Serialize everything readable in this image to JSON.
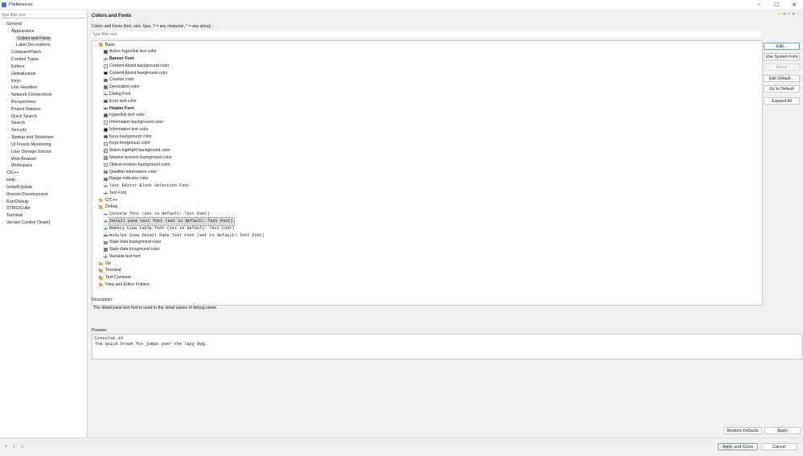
{
  "window": {
    "title": "Preferences",
    "controls": [
      "–",
      "☐",
      "✕"
    ]
  },
  "nav": {
    "filter_placeholder": "type filter text",
    "items": [
      {
        "label": "General",
        "twisty": "⌄"
      },
      {
        "label": "Appearance",
        "twisty": "⌄"
      },
      {
        "label": "Colors and Fonts",
        "selected": true
      },
      {
        "label": "Label Decorations"
      },
      {
        "label": "Compare/Patch"
      },
      {
        "label": "Content Types"
      },
      {
        "label": "Editors",
        "twisty": "›"
      },
      {
        "label": "Globalization"
      },
      {
        "label": "Keys"
      },
      {
        "label": "Link Handlers"
      },
      {
        "label": "Network Connections",
        "twisty": "›"
      },
      {
        "label": "Perspectives"
      },
      {
        "label": "Project Natures"
      },
      {
        "label": "Quick Search"
      },
      {
        "label": "Search"
      },
      {
        "label": "Security",
        "twisty": "›"
      },
      {
        "label": "Startup and Shutdown",
        "twisty": "›"
      },
      {
        "label": "UI Freeze Monitoring"
      },
      {
        "label": "User Storage Service",
        "twisty": "›"
      },
      {
        "label": "Web Browser"
      },
      {
        "label": "Workspace",
        "twisty": "›"
      },
      {
        "label": "C/C++",
        "twisty": "›"
      },
      {
        "label": "Help",
        "twisty": "›"
      },
      {
        "label": "Install/Update",
        "twisty": "›"
      },
      {
        "label": "Remote Development",
        "twisty": "›"
      },
      {
        "label": "Run/Debug",
        "twisty": "›"
      },
      {
        "label": "STM32Cube",
        "twisty": "›"
      },
      {
        "label": "Terminal"
      },
      {
        "label": "Version Control (Team)",
        "twisty": "›"
      }
    ]
  },
  "page": {
    "title": "Colors and Fonts",
    "subtitle": "Colors and Fonts (font, size, type, ? = any character, * = any string) :",
    "filter_placeholder": "type filter text",
    "header_tools": [
      "⇦",
      "▾",
      "⇨",
      "▾",
      "⋮"
    ]
  },
  "tree": [
    {
      "kind": "folder",
      "label": "Basic",
      "twisty": "⌄"
    },
    {
      "kind": "color",
      "label": "Active hyperlink text color",
      "color": "#1b57b8"
    },
    {
      "kind": "font",
      "label": "Banner Font",
      "style": "bold"
    },
    {
      "kind": "color",
      "label": "Content Assist background color",
      "color": "#ffffff"
    },
    {
      "kind": "color",
      "label": "Content Assist foreground color",
      "color": "#111111"
    },
    {
      "kind": "color",
      "label": "Counter color",
      "color": "#1e64b5"
    },
    {
      "kind": "color",
      "label": "Decoration color",
      "color": "#7a6f4a"
    },
    {
      "kind": "font",
      "label": "Dialog Font"
    },
    {
      "kind": "color",
      "label": "Error text color",
      "color": "#e01010"
    },
    {
      "kind": "font",
      "label": "Header Font",
      "style": "bold"
    },
    {
      "kind": "color",
      "label": "Hyperlink text color",
      "color": "#1b57b8"
    },
    {
      "kind": "color",
      "label": "Information background color",
      "color": "#ffffff"
    },
    {
      "kind": "color",
      "label": "Information text color",
      "color": "#111111"
    },
    {
      "kind": "color",
      "label": "Keys background color",
      "color": "#4a4a4a"
    },
    {
      "kind": "color",
      "label": "Keys foreground color",
      "color": "#ffffff"
    },
    {
      "kind": "color",
      "label": "Match highlight background color",
      "color": "#d0d0d0"
    },
    {
      "kind": "color",
      "label": "Newest revision background color",
      "color": "#a0a0a0"
    },
    {
      "kind": "color",
      "label": "Oldest revision background color",
      "color": "#ececec"
    },
    {
      "kind": "color",
      "label": "Qualifier information color",
      "color": "#8a8a8a"
    },
    {
      "kind": "color",
      "label": "Range indicator color",
      "color": "#2f6fb0"
    },
    {
      "kind": "font",
      "label": "Text Editor Block Selection Font",
      "style": "mono"
    },
    {
      "kind": "font",
      "label": "Text Font"
    },
    {
      "kind": "folder",
      "label": "C/C++",
      "twisty": "›"
    },
    {
      "kind": "folder",
      "label": "Debug",
      "twisty": "⌄"
    },
    {
      "kind": "font",
      "label": "Console font (set to default: Text Font)",
      "style": "mono"
    },
    {
      "kind": "font",
      "label": "Detail pane text font (set to default: Text Font)",
      "style": "mono",
      "selected": true
    },
    {
      "kind": "font",
      "label": "Memory view table font (set to default: Text Font)",
      "style": "mono"
    },
    {
      "kind": "font",
      "label": "Modules View Detail Pane Text Font (set to default: Text Font)",
      "style": "mono"
    },
    {
      "kind": "color",
      "label": "Stale data background color",
      "color": "#9a9a9a"
    },
    {
      "kind": "color",
      "label": "Stale data foreground color",
      "color": "#7a7a7a"
    },
    {
      "kind": "font",
      "label": "Variable text font"
    },
    {
      "kind": "folder",
      "label": "Git",
      "twisty": "›"
    },
    {
      "kind": "folder",
      "label": "Terminal",
      "twisty": "›"
    },
    {
      "kind": "folder",
      "label": "Text Compare",
      "twisty": "›"
    },
    {
      "kind": "folder",
      "label": "View and Editor Folders",
      "twisty": "›"
    }
  ],
  "side_buttons": {
    "edit": "Edit...",
    "use_system_font": "Use System Font",
    "reset": "Reset",
    "edit_default": "Edit Default...",
    "go_to_default": "Go to Default",
    "expand_all": "Expand All"
  },
  "description": {
    "label": "Description:",
    "text": "The detail pane text font is used in the detail panes of debug views."
  },
  "preview": {
    "label": "Preview:",
    "lines": [
      "Consolas 10",
      "The quick brown fox jumps over the lazy dog."
    ]
  },
  "footer": {
    "restore_defaults": "Restore Defaults",
    "apply": "Apply",
    "apply_and_close": "Apply and Close",
    "cancel": "Cancel",
    "icons": [
      "?",
      "⇩",
      "⇧"
    ]
  }
}
